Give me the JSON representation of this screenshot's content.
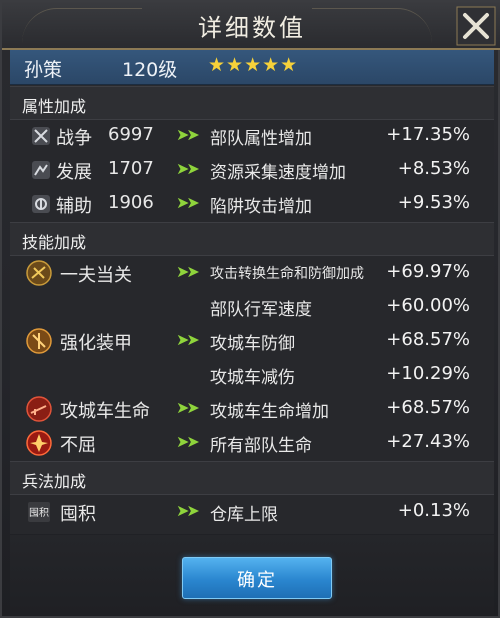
{
  "header": {
    "title": "详细数值"
  },
  "hero": {
    "name": "孙策",
    "level": "120级",
    "stars": "★★★★★"
  },
  "sections": {
    "attributes": {
      "title": "属性加成",
      "rows": [
        {
          "name": "战争",
          "value_num": "6997",
          "effect": "部队属性增加",
          "bonus": "+17.35%",
          "icon": "crossed-swords-icon"
        },
        {
          "name": "发展",
          "value_num": "1707",
          "effect": "资源采集速度增加",
          "bonus": "+8.53%",
          "icon": "development-icon"
        },
        {
          "name": "辅助",
          "value_num": "1906",
          "effect": "陷阱攻击增加",
          "bonus": "+9.53%",
          "icon": "support-icon"
        }
      ]
    },
    "skills": {
      "title": "技能加成",
      "rows": [
        {
          "name": "一夫当关",
          "effect": "攻击转换生命和防御加成",
          "bonus": "+69.97%",
          "icon": "skill-guard-icon"
        },
        {
          "name": "",
          "effect": "部队行军速度",
          "bonus": "+60.00%"
        },
        {
          "name": "强化装甲",
          "effect": "攻城车防御",
          "bonus": "+68.57%",
          "icon": "skill-armor-icon"
        },
        {
          "name": "",
          "effect": "攻城车减伤",
          "bonus": "+10.29%"
        },
        {
          "name": "攻城车生命",
          "effect": "攻城车生命增加",
          "bonus": "+68.57%",
          "icon": "skill-siege-icon"
        },
        {
          "name": "不屈",
          "effect": "所有部队生命",
          "bonus": "+27.43%",
          "icon": "skill-unyielding-icon"
        }
      ]
    },
    "tactics": {
      "title": "兵法加成",
      "rows": [
        {
          "name": "囤积",
          "effect": "仓库上限",
          "bonus": "+0.13%",
          "icon": "hoard-icon",
          "icon_text": "囤积"
        }
      ]
    }
  },
  "arrow": "➤➤",
  "footer": {
    "confirm_label": "确定"
  },
  "colors": {
    "accent_green": "#8fd43c",
    "star_gold": "#f6d13a",
    "button_blue": "#2a86cf",
    "hero_bar": "#2b4767"
  }
}
